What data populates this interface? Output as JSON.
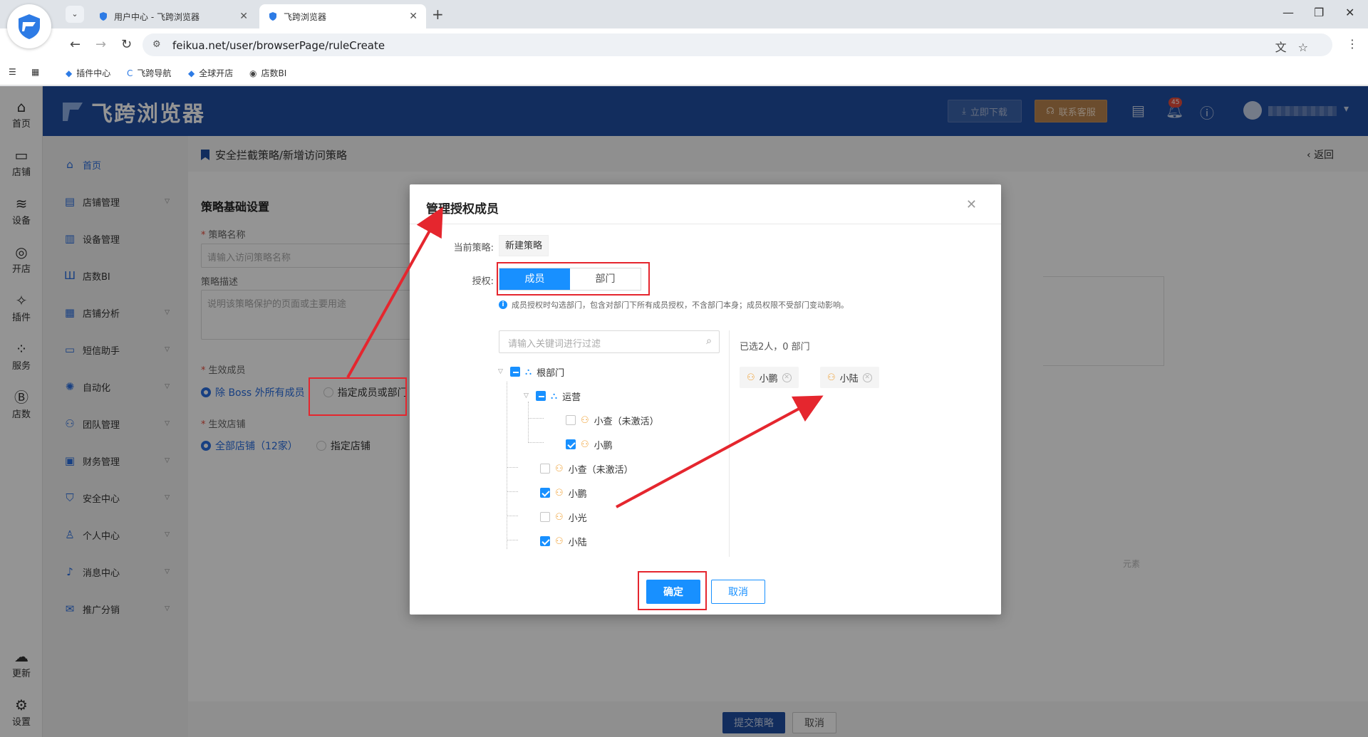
{
  "browser": {
    "tabs": [
      {
        "title": "用户中心 - 飞跨浏览器",
        "active": false
      },
      {
        "title": "飞跨浏览器",
        "active": true
      }
    ],
    "url": "feikua.net/user/browserPage/ruleCreate",
    "bookmarks": [
      "插件中心",
      "飞跨导航",
      "全球开店",
      "店数BI"
    ]
  },
  "rail": {
    "items": [
      {
        "label": "首页",
        "icon": "home-icon"
      },
      {
        "label": "店铺",
        "icon": "store-icon"
      },
      {
        "label": "设备",
        "icon": "layers-icon"
      },
      {
        "label": "开店",
        "icon": "planet-icon"
      },
      {
        "label": "插件",
        "icon": "puzzle-icon"
      },
      {
        "label": "服务",
        "icon": "grid-icon"
      },
      {
        "label": "店数",
        "icon": "bi-icon"
      }
    ],
    "bottom": [
      {
        "label": "更新",
        "icon": "cloud-upload-icon"
      },
      {
        "label": "设置",
        "icon": "settings-icon"
      }
    ]
  },
  "header": {
    "brand": "飞跨浏览器",
    "download": "立即下载",
    "service": "联系客服",
    "notification_count": "45"
  },
  "sidemenu": {
    "items": [
      {
        "label": "首页",
        "active": true,
        "has_children": false
      },
      {
        "label": "店铺管理",
        "active": false,
        "has_children": true
      },
      {
        "label": "设备管理",
        "active": false,
        "has_children": false
      },
      {
        "label": "店数BI",
        "active": false,
        "has_children": false
      },
      {
        "label": "店铺分析",
        "active": false,
        "has_children": true
      },
      {
        "label": "短信助手",
        "active": false,
        "has_children": true
      },
      {
        "label": "自动化",
        "active": false,
        "has_children": true
      },
      {
        "label": "团队管理",
        "active": false,
        "has_children": true
      },
      {
        "label": "财务管理",
        "active": false,
        "has_children": true
      },
      {
        "label": "安全中心",
        "active": false,
        "has_children": true
      },
      {
        "label": "个人中心",
        "active": false,
        "has_children": true
      },
      {
        "label": "消息中心",
        "active": false,
        "has_children": true
      },
      {
        "label": "推广分销",
        "active": false,
        "has_children": true
      }
    ]
  },
  "page": {
    "breadcrumb": "安全拦截策略/新增访问策略",
    "back": "返回",
    "section_title": "策略基础设置",
    "name_label": "策略名称",
    "name_placeholder": "请输入访问策略名称",
    "desc_label": "策略描述",
    "desc_placeholder": "说明该策略保护的页面或主要用途",
    "members_label": "生效成员",
    "members_opt_all": "除 Boss 外所有成员",
    "members_opt_specific": "指定成员或部门",
    "stores_label": "生效店铺",
    "stores_opt_all": "全部店铺（12家）",
    "stores_opt_specific": "指定店铺",
    "faint_tail": "元素",
    "submit": "提交策略",
    "cancel": "取消"
  },
  "modal": {
    "title": "管理授权成员",
    "policy_label": "当前策略:",
    "policy_value": "新建策略",
    "auth_label": "授权:",
    "seg_member": "成员",
    "seg_dept": "部门",
    "hint": "成员授权时勾选部门，包含对部门下所有成员授权，不含部门本身；成员权限不受部门变动影响。",
    "filter_placeholder": "请输入关键词进行过滤",
    "tree": [
      {
        "label": "根部门",
        "type": "dept",
        "state": "partial"
      },
      {
        "label": "运营",
        "type": "dept",
        "state": "partial"
      },
      {
        "label": "小查（未激活）",
        "type": "user",
        "state": "unchecked"
      },
      {
        "label": "小鹏",
        "type": "user",
        "state": "checked"
      },
      {
        "label": "小查（未激活）",
        "type": "user",
        "state": "unchecked"
      },
      {
        "label": "小鹏",
        "type": "user",
        "state": "checked"
      },
      {
        "label": "小光",
        "type": "user",
        "state": "unchecked"
      },
      {
        "label": "小陆",
        "type": "user",
        "state": "checked"
      }
    ],
    "selected_summary": "已选2人，0 部门",
    "selected": [
      "小鹏",
      "小陆"
    ],
    "ok": "确定",
    "cancel": "取消"
  },
  "colors": {
    "brand_blue": "#1f4ea3",
    "primary": "#1890ff",
    "annotation_red": "#e5262e",
    "user_icon": "#f0a33a"
  }
}
